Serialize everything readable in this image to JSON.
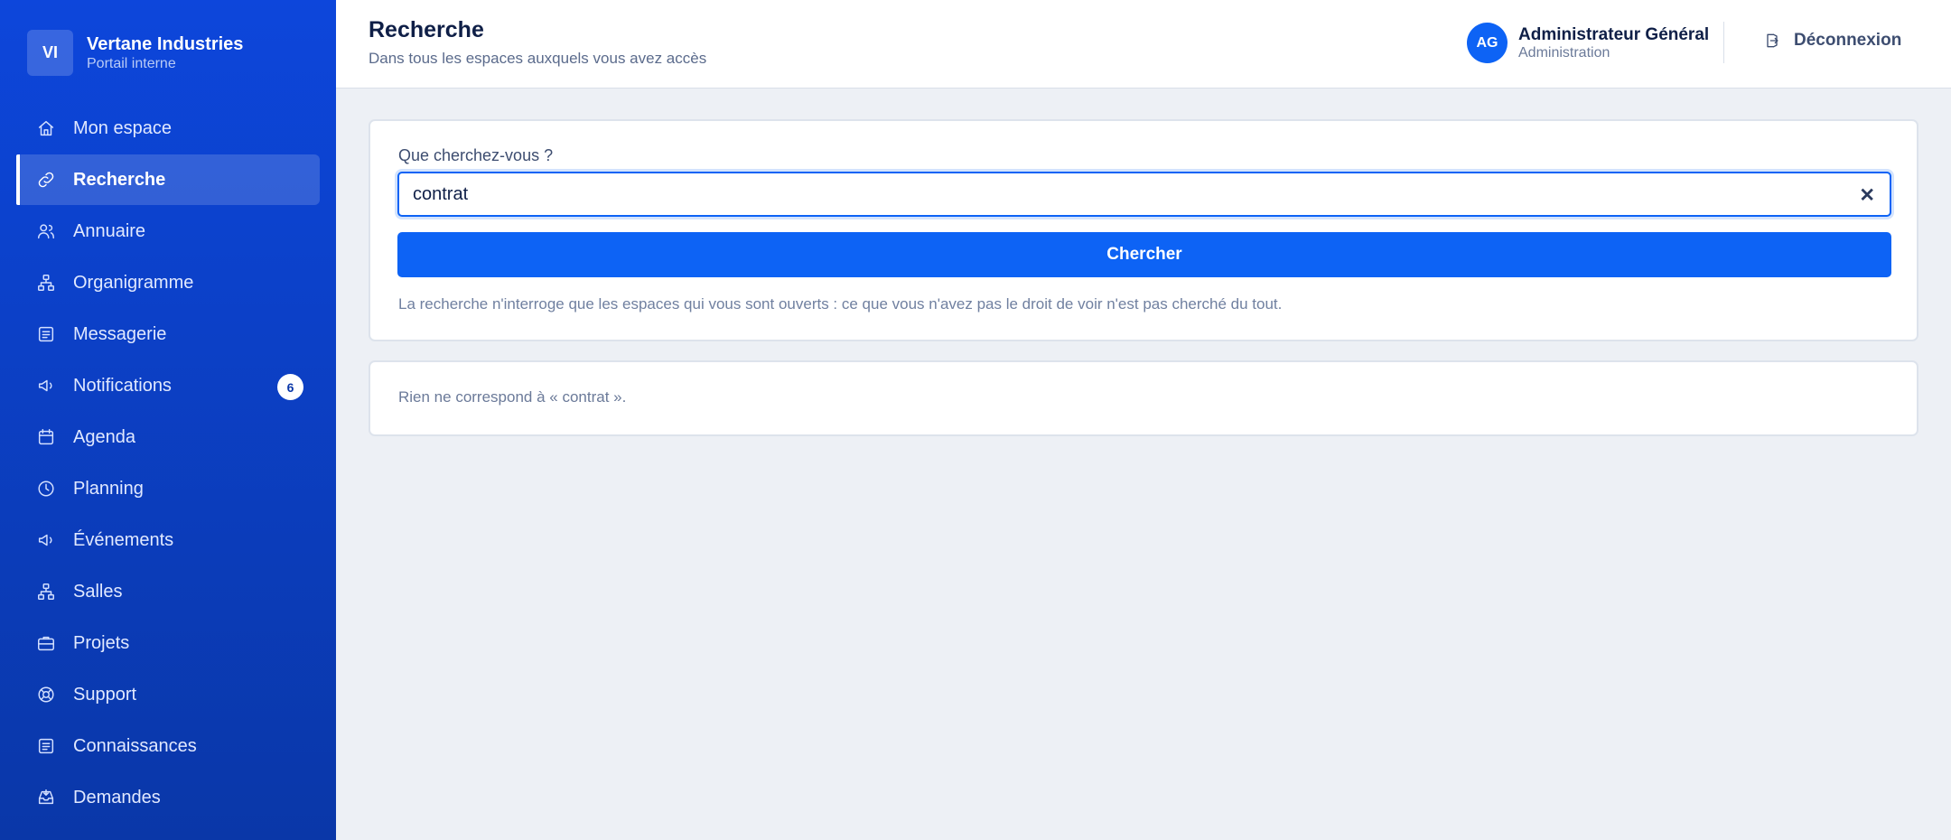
{
  "brand": {
    "logo": "VI",
    "name": "Vertane Industries",
    "sub": "Portail interne"
  },
  "sidebar": {
    "items": [
      {
        "label": "Mon espace",
        "icon": "home-icon"
      },
      {
        "label": "Recherche",
        "icon": "link-icon",
        "active": true
      },
      {
        "label": "Annuaire",
        "icon": "users-icon"
      },
      {
        "label": "Organigramme",
        "icon": "org-chart-icon"
      },
      {
        "label": "Messagerie",
        "icon": "document-icon"
      },
      {
        "label": "Notifications",
        "icon": "megaphone-icon",
        "badge": "6"
      },
      {
        "label": "Agenda",
        "icon": "calendar-icon"
      },
      {
        "label": "Planning",
        "icon": "clock-icon"
      },
      {
        "label": "Événements",
        "icon": "megaphone-icon"
      },
      {
        "label": "Salles",
        "icon": "org-chart-icon"
      },
      {
        "label": "Projets",
        "icon": "briefcase-icon"
      },
      {
        "label": "Support",
        "icon": "lifebuoy-icon"
      },
      {
        "label": "Connaissances",
        "icon": "document-icon"
      },
      {
        "label": "Demandes",
        "icon": "inbox-icon"
      }
    ]
  },
  "header": {
    "title": "Recherche",
    "subtitle": "Dans tous les espaces auxquels vous avez accès",
    "user": {
      "initials": "AG",
      "name": "Administrateur Général",
      "role": "Administration"
    },
    "logout_label": "Déconnexion"
  },
  "search": {
    "label": "Que cherchez-vous ?",
    "value": "contrat",
    "button_label": "Chercher",
    "hint": "La recherche n'interroge que les espaces qui vous sont ouverts : ce que vous n'avez pas le droit de voir n'est pas cherché du tout."
  },
  "results": {
    "empty_message": "Rien ne correspond à « contrat »."
  },
  "colors": {
    "accent": "#0d63f5",
    "sidebar_top": "#0d46db",
    "sidebar_bottom": "#0a37a8"
  }
}
